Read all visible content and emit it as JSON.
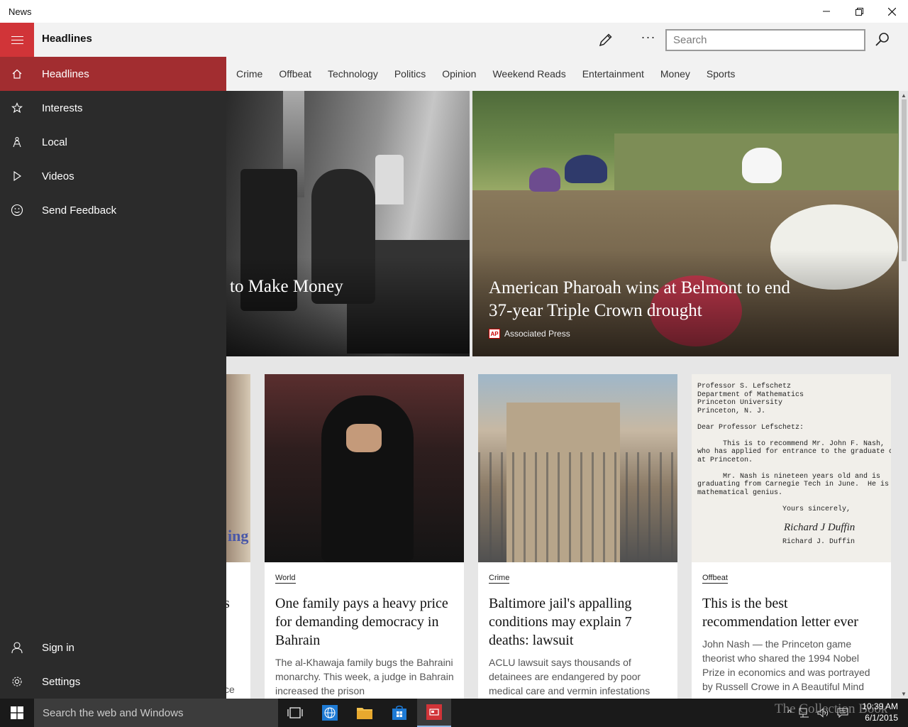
{
  "window": {
    "title": "News"
  },
  "header": {
    "title": "Headlines",
    "search_placeholder": "Search"
  },
  "tabs": [
    "Crime",
    "Offbeat",
    "Technology",
    "Politics",
    "Opinion",
    "Weekend Reads",
    "Entertainment",
    "Money",
    "Sports"
  ],
  "sidebar": {
    "items": [
      {
        "label": "Headlines",
        "icon": "home-icon"
      },
      {
        "label": "Interests",
        "icon": "star-icon"
      },
      {
        "label": "Local",
        "icon": "local-icon"
      },
      {
        "label": "Videos",
        "icon": "play-icon"
      },
      {
        "label": "Send Feedback",
        "icon": "smiley-icon"
      }
    ],
    "bottom_items": [
      {
        "label": "Sign in",
        "icon": "person-icon"
      },
      {
        "label": "Settings",
        "icon": "gear-icon"
      }
    ]
  },
  "hero": [
    {
      "headline": "to Make Money"
    },
    {
      "headline": "American Pharoah wins at Belmont to end 37-year Triple Crown drought",
      "source": "Associated Press",
      "source_logo": "AP"
    }
  ],
  "cards": [
    {
      "title_fragment": "s",
      "desc_fragment": "ce",
      "img_text": "ing F"
    },
    {
      "category": "World",
      "title": "One family pays a heavy price for demanding democracy in Bahrain",
      "desc": "The al-Khawaja family bugs the Bahraini monarchy. This week, a judge in Bahrain increased the prison"
    },
    {
      "category": "Crime",
      "title": "Baltimore jail's appalling conditions may explain 7 deaths: lawsuit",
      "desc": "ACLU lawsuit says thousands of detainees are endangered by poor medical care and vermin infestations"
    },
    {
      "category": "Offbeat",
      "title": "This is the best recommendation letter ever",
      "desc": "John Nash — the Princeton game theorist who shared the 1994 Nobel Prize in economics and was portrayed by Russell Crowe in A Beautiful Mind",
      "letter_text": "Professor S. Lefschetz\nDepartment of Mathematics\nPrinceton University\nPrinceton, N. J.\n\nDear Professor Lefschetz:\n\n      This is to recommend Mr. John F. Nash,\nwho has applied for entrance to the graduate coll\nat Princeton.\n\n      Mr. Nash is nineteen years old and is\ngraduating from Carnegie Tech in June.  He is a\nmathematical genius.\n\n                    Yours sincerely,\n\n\n\n                    Richard J. Duffin",
      "signature": "Richard J Duffin"
    }
  ],
  "taskbar": {
    "search_placeholder": "Search the web and Windows",
    "watermark": "The Collection Book",
    "time": "10:39 AM",
    "date": "6/1/2015"
  }
}
